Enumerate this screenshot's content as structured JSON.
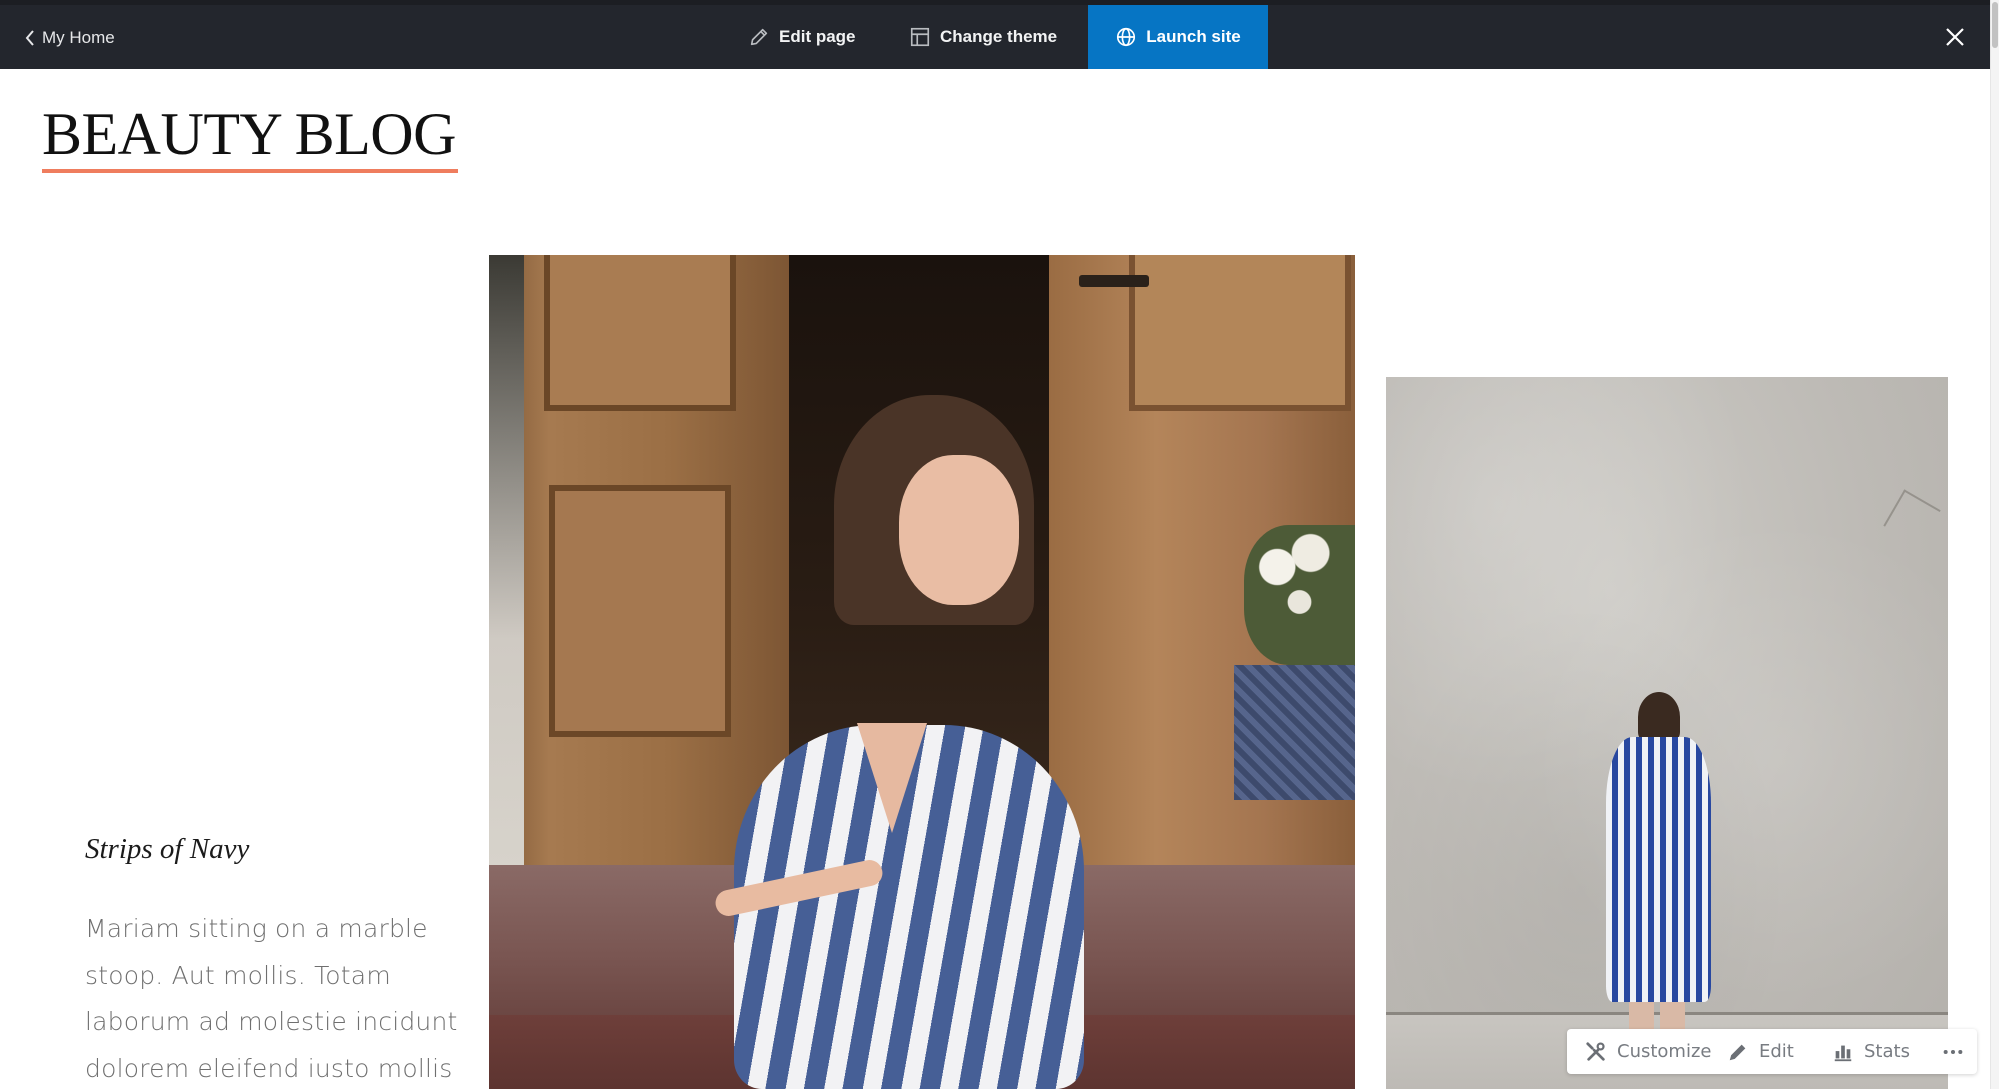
{
  "topbar": {
    "back_label": "My Home",
    "back_icon": "chevron-left-icon",
    "actions": [
      {
        "label": "Edit page",
        "icon": "pencil-icon"
      },
      {
        "label": "Change theme",
        "icon": "layout-icon"
      },
      {
        "label": "Launch site",
        "icon": "globe-icon",
        "primary": true
      }
    ],
    "close_icon": "close-icon",
    "colors": {
      "background": "#23262d",
      "primary": "#0675c4",
      "text": "#f2f3f4"
    }
  },
  "site": {
    "title": "BEAUTY BLOG",
    "title_underline_color": "#ef7d5e"
  },
  "post": {
    "title": "Strips of Navy",
    "excerpt": "Mariam sitting on a marble stoop. Aut mollis. Totam laborum ad molestie incidunt dolorem eleifend iusto mollis",
    "images": [
      {
        "alt": "Woman in navy-and-white striped dress sitting on a marble stoop in front of wooden doors"
      },
      {
        "alt": "Woman in navy-and-white striped dress standing facing a grey wall"
      }
    ]
  },
  "floating_toolbar": {
    "items": [
      {
        "label": "Customize",
        "icon": "tools-icon"
      },
      {
        "label": "Edit",
        "icon": "pencil-icon"
      },
      {
        "label": "Stats",
        "icon": "bar-chart-icon"
      },
      {
        "label": "",
        "icon": "ellipsis-icon"
      }
    ]
  }
}
